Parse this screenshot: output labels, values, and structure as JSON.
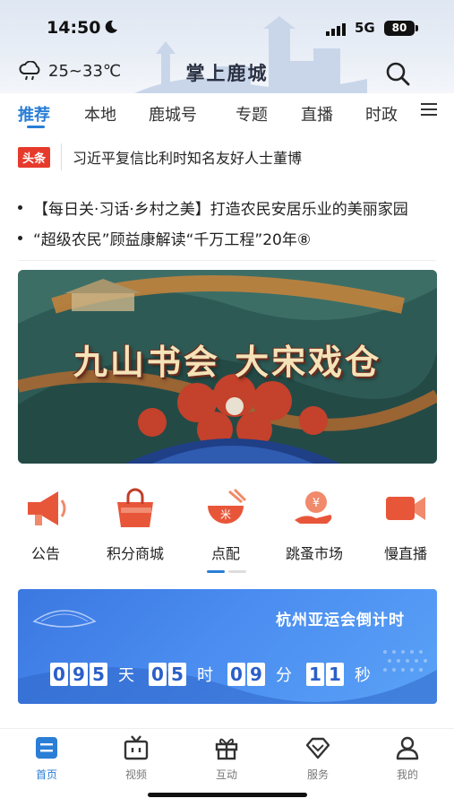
{
  "status_bar": {
    "time": "14:50",
    "network": "5G",
    "battery": "80"
  },
  "header": {
    "temperature": "25~33℃",
    "app_title": "掌上鹿城"
  },
  "tabs": [
    {
      "label": "推荐",
      "active": true
    },
    {
      "label": "本地"
    },
    {
      "label": "鹿城号"
    },
    {
      "label": "专题"
    },
    {
      "label": "直播"
    },
    {
      "label": "时政"
    }
  ],
  "headline": {
    "badge": "头条",
    "text": "习近平复信比利时知名友好人士董博"
  },
  "news": [
    "【每日关·习话·乡村之美】打造农民安居乐业的美丽家园",
    "“超级农民”顾益康解读“千万工程”20年⑧"
  ],
  "banner": {
    "text": "九山书会 大宋戏仓"
  },
  "quick_entries": [
    {
      "label": "公告",
      "icon": "megaphone-icon"
    },
    {
      "label": "积分商城",
      "icon": "shopping-bag-icon"
    },
    {
      "label": "点配",
      "icon": "rice-bowl-icon"
    },
    {
      "label": "跳蚤市场",
      "icon": "yuan-hand-icon"
    },
    {
      "label": "慢直播",
      "icon": "video-camera-icon"
    }
  ],
  "countdown": {
    "title": "杭州亚运会倒计时",
    "days": "095",
    "days_unit": "天",
    "hours": "05",
    "hours_unit": "时",
    "minutes": "09",
    "minutes_unit": "分",
    "seconds": "11",
    "seconds_unit": "秒"
  },
  "bottom_nav": [
    {
      "label": "首页",
      "icon": "home-icon",
      "active": true
    },
    {
      "label": "视频",
      "icon": "tv-icon"
    },
    {
      "label": "互动",
      "icon": "gift-icon"
    },
    {
      "label": "服务",
      "icon": "heart-diamond-icon"
    },
    {
      "label": "我的",
      "icon": "person-icon"
    }
  ],
  "colors": {
    "accent": "#2a7ed6",
    "badge": "#e63a2c",
    "countdown_bg": "#4a8cf0"
  }
}
